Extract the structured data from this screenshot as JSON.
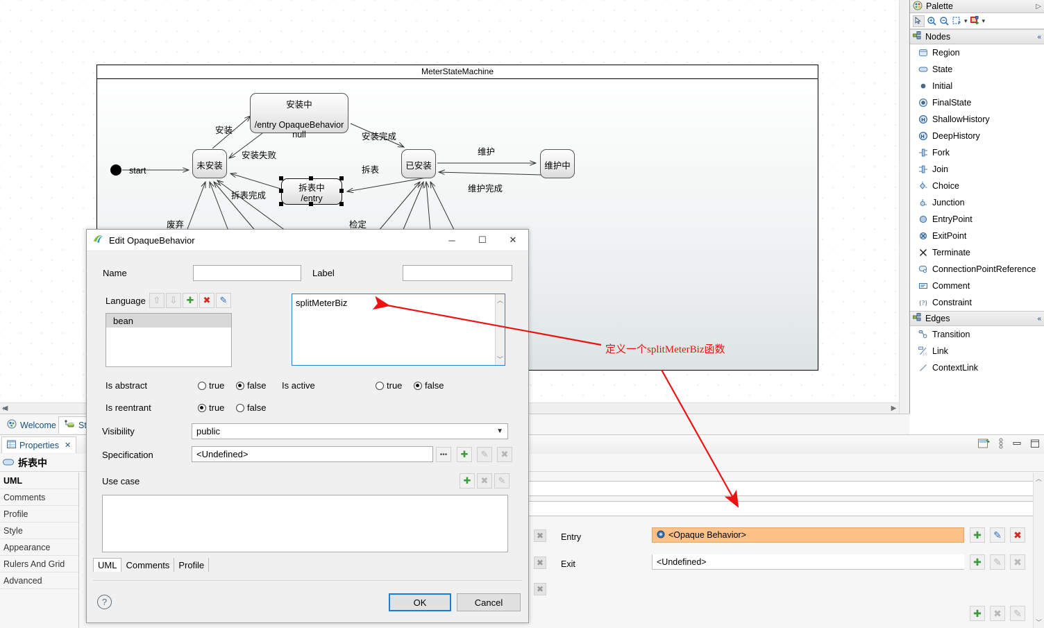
{
  "diagram": {
    "title": "MeterStateMachine",
    "states": [
      {
        "id": "installing",
        "name": "安装中",
        "body": "/entry OpaqueBehavior null"
      },
      {
        "id": "notinstalled",
        "name": "未安装",
        "body": ""
      },
      {
        "id": "installed",
        "name": "已安装",
        "body": ""
      },
      {
        "id": "maintaining",
        "name": "维护中",
        "body": ""
      },
      {
        "id": "dismantling",
        "name": "拆表中",
        "body": "/entry"
      }
    ],
    "transitions": [
      {
        "label": "start"
      },
      {
        "label": "安装"
      },
      {
        "label": "安装失败"
      },
      {
        "label": "安装完成"
      },
      {
        "label": "拆表"
      },
      {
        "label": "拆表完成"
      },
      {
        "label": "维护"
      },
      {
        "label": "维护完成"
      },
      {
        "label": "废弃"
      },
      {
        "label": "检定"
      }
    ]
  },
  "palette": {
    "title": "Palette",
    "toolbar": [
      {
        "name": "select-tool",
        "glyph": "arrow"
      },
      {
        "name": "zoom-in-tool",
        "glyph": "zoom-in"
      },
      {
        "name": "zoom-out-tool",
        "glyph": "zoom-out"
      },
      {
        "name": "marquee-tool",
        "glyph": "marquee"
      },
      {
        "name": "marquee-dropdown",
        "glyph": "caret"
      },
      {
        "name": "format-tool",
        "glyph": "format"
      },
      {
        "name": "format-dropdown",
        "glyph": "caret"
      }
    ],
    "sections": [
      {
        "title": "Nodes",
        "items": [
          {
            "label": "Region",
            "icon": "region-icon"
          },
          {
            "label": "State",
            "icon": "state-icon"
          },
          {
            "label": "Initial",
            "icon": "initial-icon"
          },
          {
            "label": "FinalState",
            "icon": "finalstate-icon"
          },
          {
            "label": "ShallowHistory",
            "icon": "shallowhistory-icon"
          },
          {
            "label": "DeepHistory",
            "icon": "deephistory-icon"
          },
          {
            "label": "Fork",
            "icon": "fork-icon"
          },
          {
            "label": "Join",
            "icon": "join-icon"
          },
          {
            "label": "Choice",
            "icon": "choice-icon"
          },
          {
            "label": "Junction",
            "icon": "junction-icon"
          },
          {
            "label": "EntryPoint",
            "icon": "entrypoint-icon"
          },
          {
            "label": "ExitPoint",
            "icon": "exitpoint-icon"
          },
          {
            "label": "Terminate",
            "icon": "terminate-icon"
          },
          {
            "label": "ConnectionPointReference",
            "icon": "connectionpointreference-icon"
          },
          {
            "label": "Comment",
            "icon": "comment-icon"
          },
          {
            "label": "Constraint",
            "icon": "constraint-icon"
          }
        ]
      },
      {
        "title": "Edges",
        "items": [
          {
            "label": "Transition",
            "icon": "transition-icon"
          },
          {
            "label": "Link",
            "icon": "link-icon"
          },
          {
            "label": "ContextLink",
            "icon": "contextlink-icon"
          }
        ]
      }
    ]
  },
  "editor_tabs": [
    {
      "label": "Welcome",
      "active": false,
      "icon": "welcome-icon"
    },
    {
      "label": "Stat",
      "active": true,
      "icon": "statemachine-icon"
    }
  ],
  "properties_view": {
    "tab_label": "Properties",
    "tab_close": "✕",
    "element_name": "拆表中",
    "left_items": [
      {
        "label": "UML",
        "selected": true
      },
      {
        "label": "Comments",
        "selected": false
      },
      {
        "label": "Profile",
        "selected": false
      },
      {
        "label": "Style",
        "selected": false
      },
      {
        "label": "Appearance",
        "selected": false
      },
      {
        "label": "Rulers And Grid",
        "selected": false
      },
      {
        "label": "Advanced",
        "selected": false
      }
    ],
    "rows": [
      {
        "label": "Entry",
        "value": "<Opaque Behavior>",
        "highlighted": true,
        "icon": "opaque-behavior-icon"
      },
      {
        "label": "Exit",
        "value": "<Undefined>",
        "highlighted": false,
        "icon": ""
      }
    ],
    "toolbar_icons": [
      {
        "name": "new-wizard-icon"
      },
      {
        "name": "view-menu-icon"
      },
      {
        "name": "minimize-icon"
      },
      {
        "name": "maximize-icon"
      }
    ],
    "row_buttons": {
      "add": "✚",
      "edit": "✎",
      "delete": "✖"
    }
  },
  "dialog": {
    "title": "Edit OpaqueBehavior",
    "window_controls": {
      "minimize": "─",
      "maximize": "☐",
      "close": "✕"
    },
    "name_label": "Name",
    "name_value": "",
    "label_label": "Label",
    "label_value": "",
    "language_label": "Language",
    "language_buttons": [
      {
        "name": "move-up-button",
        "glyph": "⇧",
        "enabled": false
      },
      {
        "name": "move-down-button",
        "glyph": "⇩",
        "enabled": false
      },
      {
        "name": "add-language-button",
        "glyph": "✚",
        "enabled": true
      },
      {
        "name": "delete-language-button",
        "glyph": "✖",
        "enabled": true
      },
      {
        "name": "edit-language-button",
        "glyph": "✎",
        "enabled": true
      }
    ],
    "language_items": [
      "bean"
    ],
    "body_text": "splitMeterBiz",
    "is_abstract_label": "Is abstract",
    "is_abstract_value": "false",
    "is_active_label": "Is active",
    "is_active_value": "false",
    "is_reentrant_label": "Is reentrant",
    "is_reentrant_value": "true",
    "radio_true": "true",
    "radio_false": "false",
    "visibility_label": "Visibility",
    "visibility_value": "public",
    "specification_label": "Specification",
    "specification_value": "<Undefined>",
    "specification_buttons": [
      {
        "name": "browse-button",
        "glyph": "•••",
        "enabled": true
      },
      {
        "name": "add-button",
        "glyph": "✚",
        "enabled": true
      },
      {
        "name": "edit-button",
        "glyph": "✎",
        "enabled": false
      },
      {
        "name": "delete-button",
        "glyph": "✖",
        "enabled": false
      }
    ],
    "usecase_label": "Use case",
    "usecase_buttons": [
      {
        "name": "add-usecase-button",
        "glyph": "✚",
        "enabled": true
      },
      {
        "name": "delete-usecase-button",
        "glyph": "✖",
        "enabled": false
      },
      {
        "name": "edit-usecase-button",
        "glyph": "✎",
        "enabled": false
      }
    ],
    "tabs": [
      {
        "label": "UML",
        "active": true
      },
      {
        "label": "Comments",
        "active": false
      },
      {
        "label": "Profile",
        "active": false
      }
    ],
    "help_glyph": "?",
    "ok_label": "OK",
    "cancel_label": "Cancel"
  },
  "annotation": {
    "text": "定义一个splitMeterBiz函数",
    "color": "#ee1111"
  },
  "colors": {
    "accent": "#1a7fd4",
    "highlight_row": "#fbc187",
    "annotation": "#ee1111",
    "tab_text": "#16507b"
  }
}
